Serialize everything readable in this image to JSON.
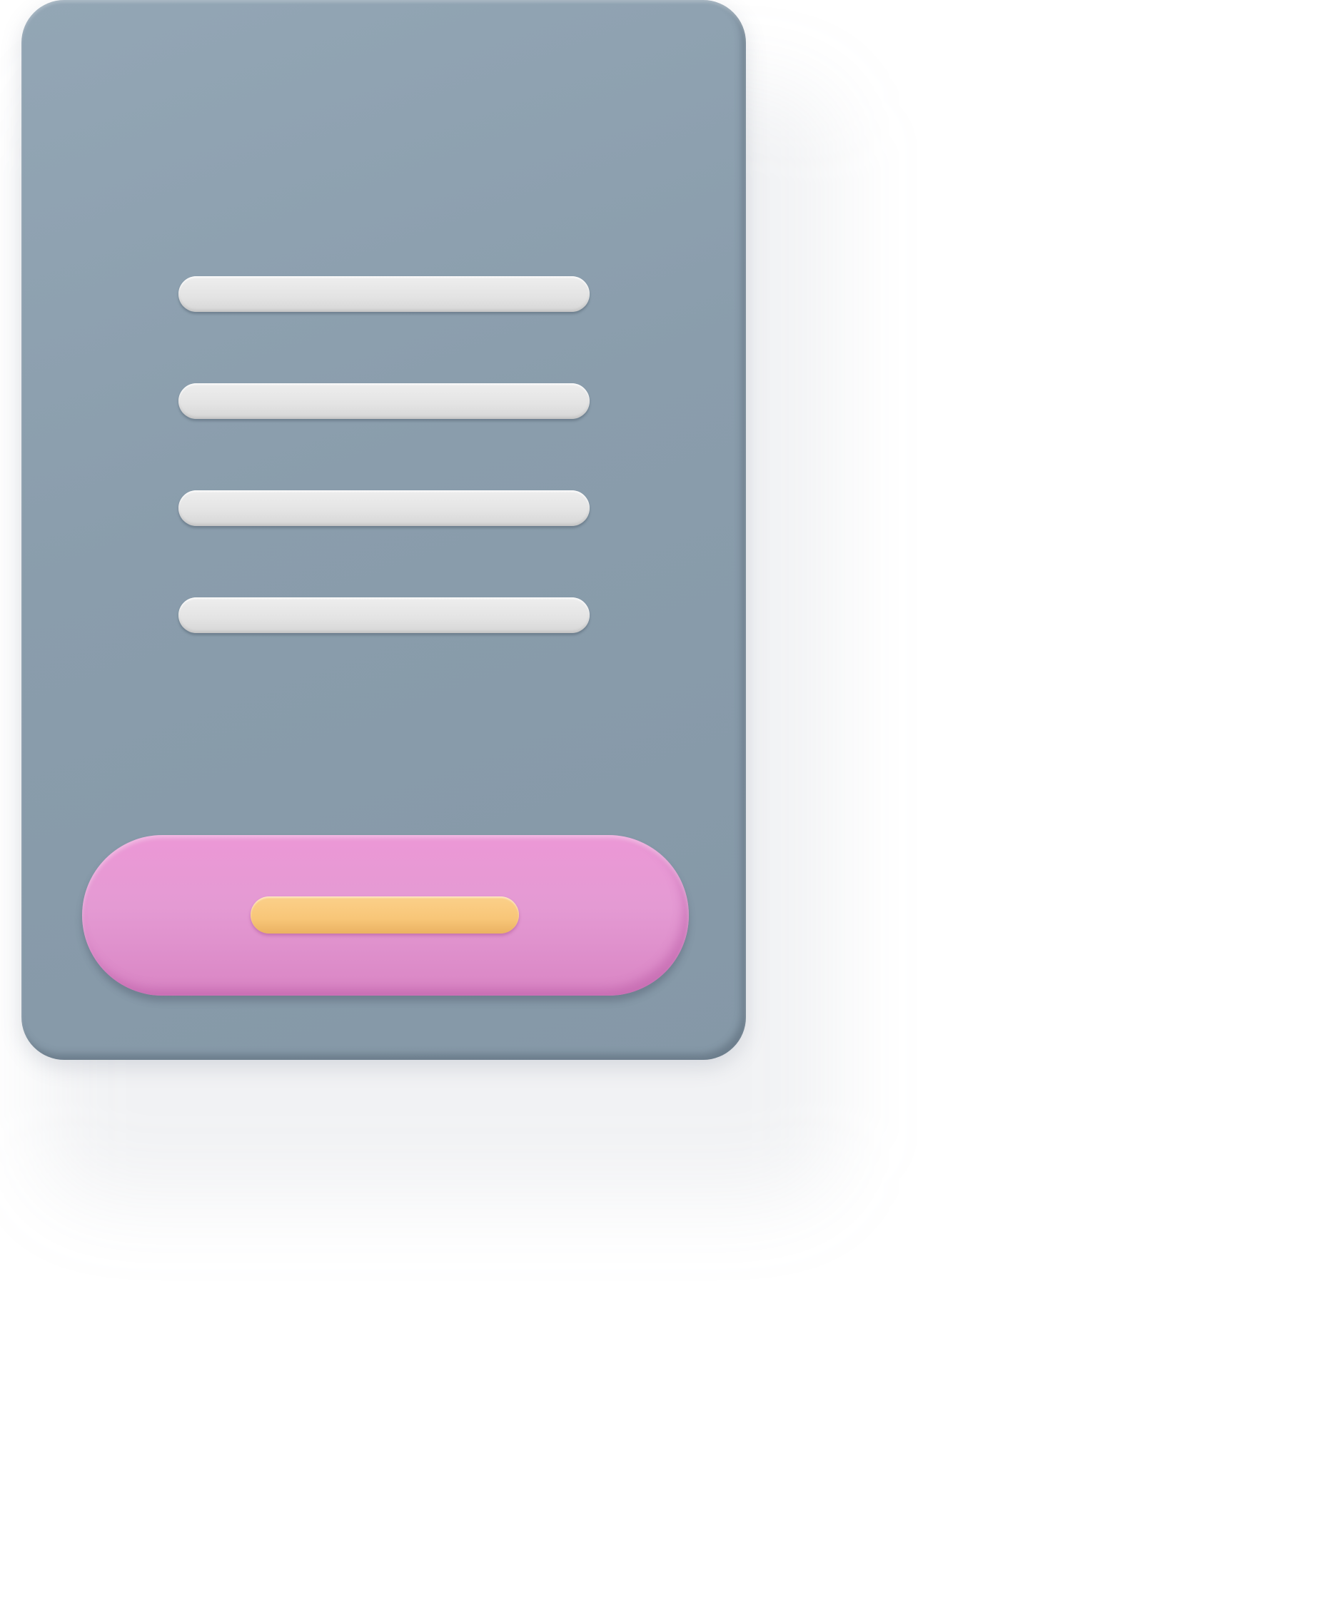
{
  "illustration": {
    "subject": "document-card-icon",
    "colors": {
      "card": "#8a9dac",
      "text_lines": "#e4e4e4",
      "button": "#e49ad3",
      "button_bar": "#f8c678",
      "background": "#ffffff"
    },
    "text_line_count": 4
  }
}
